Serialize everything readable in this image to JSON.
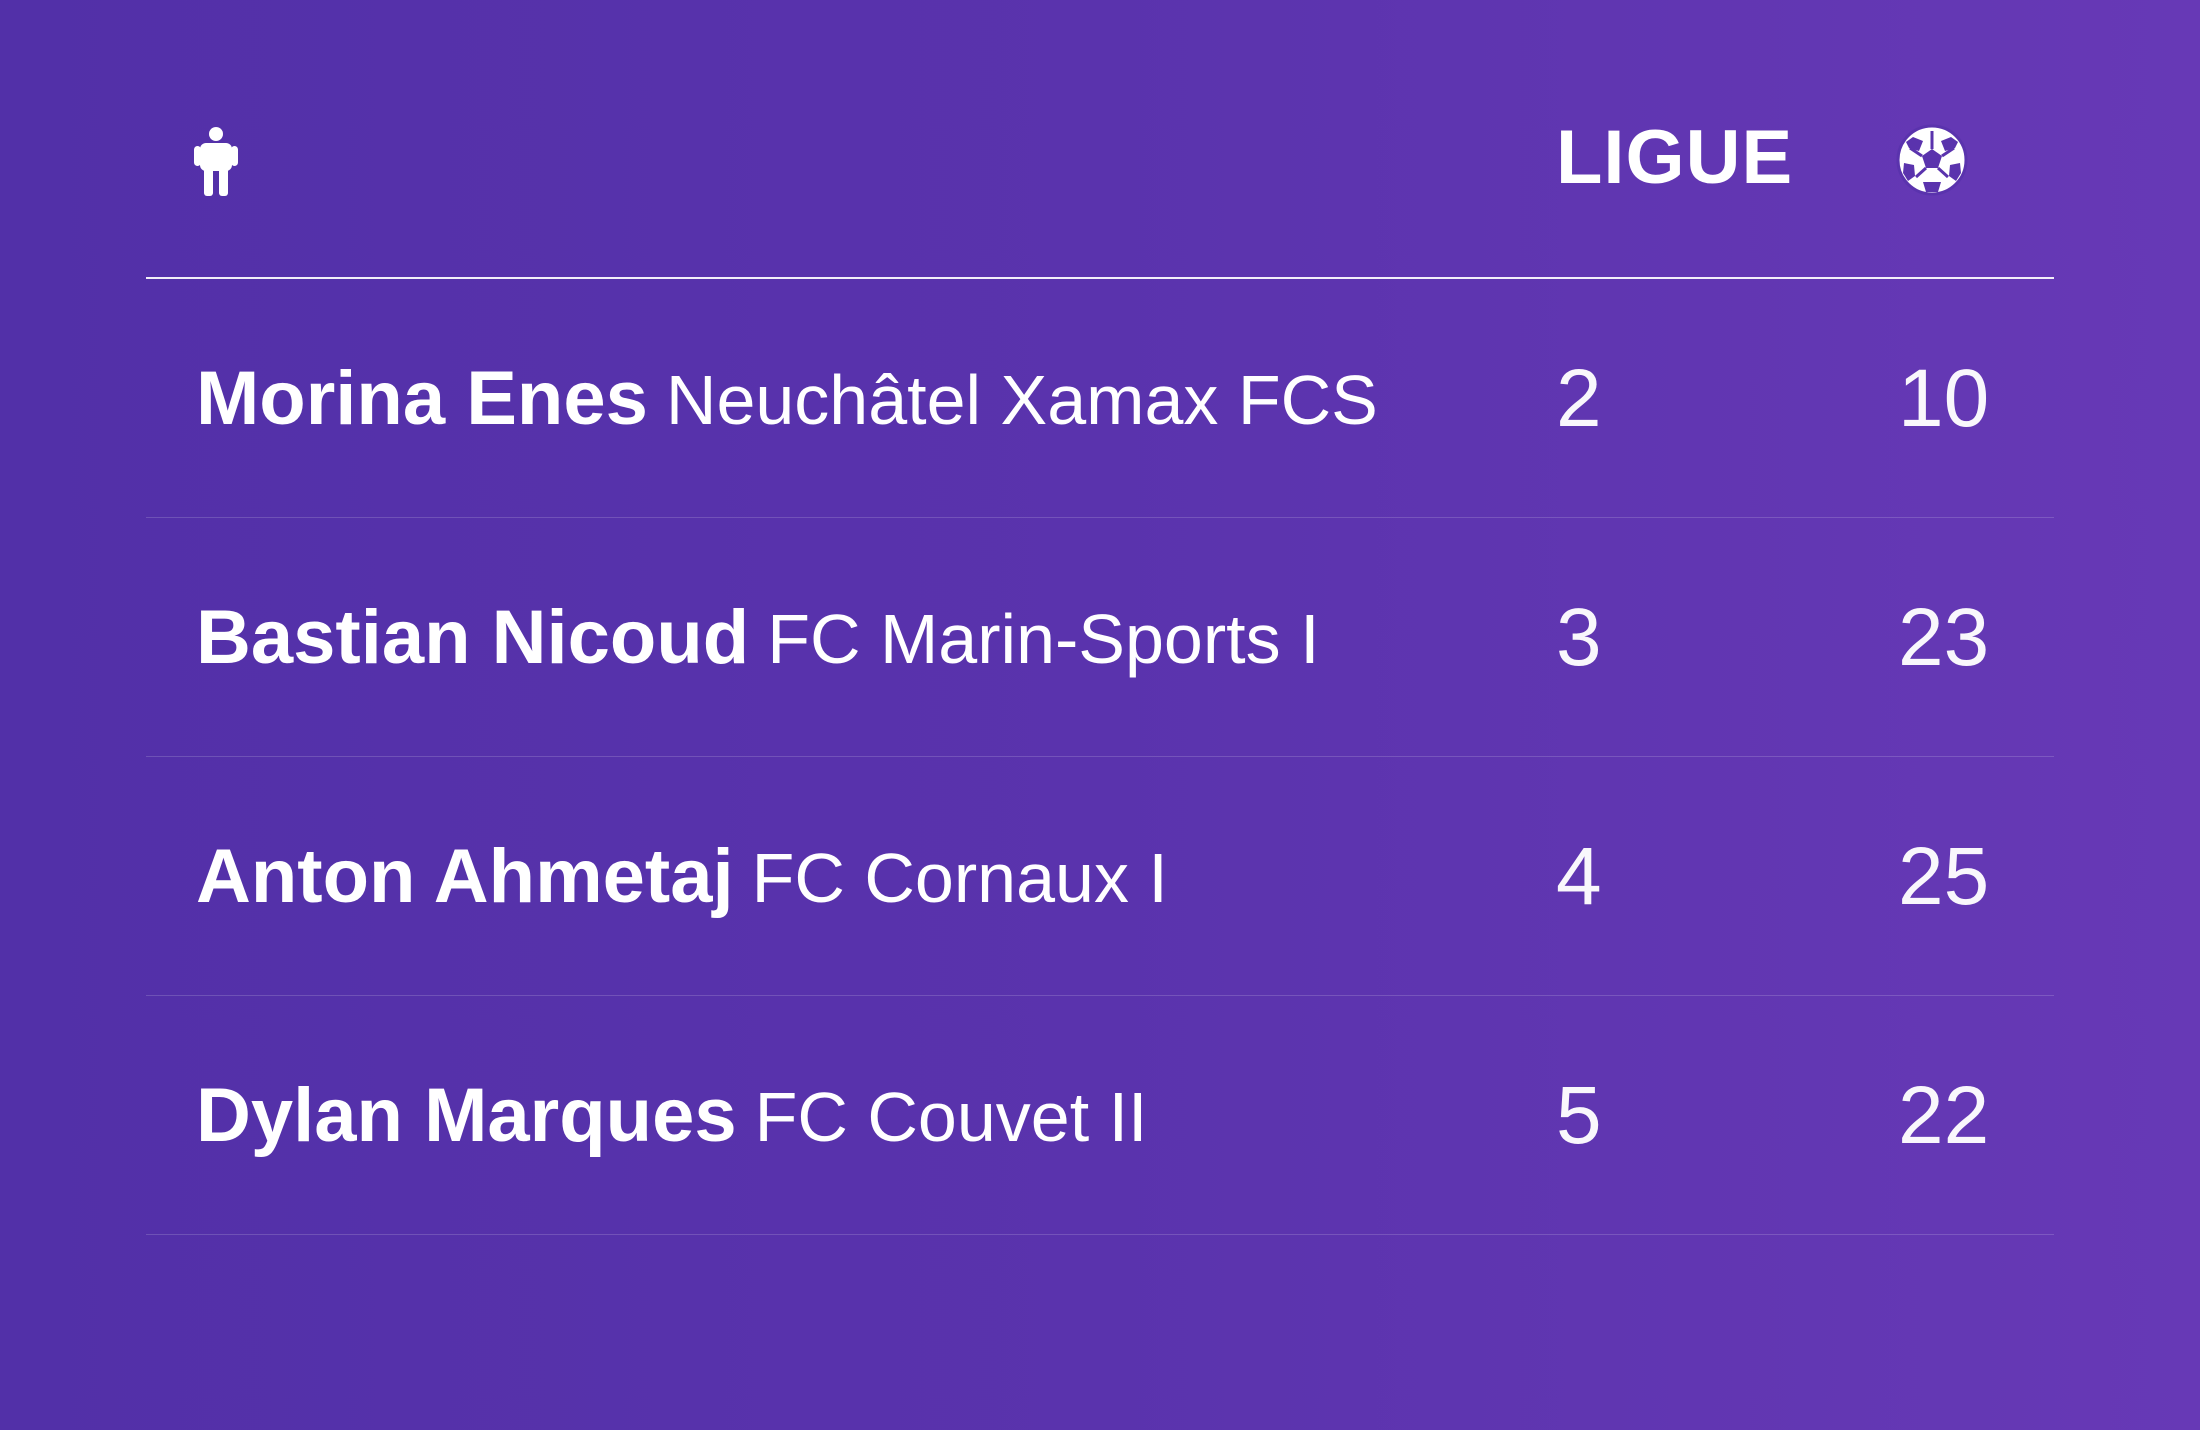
{
  "table": {
    "header": {
      "player_icon": "person-icon",
      "league_label": "LIGUE",
      "goals_icon": "soccer-ball-icon"
    },
    "rows": [
      {
        "name": "Morina Enes",
        "club": "Neuchâtel Xamax FCS",
        "league": "2",
        "goals": "10"
      },
      {
        "name": "Bastian Nicoud",
        "club": "FC Marin-Sports I",
        "league": "3",
        "goals": "23"
      },
      {
        "name": "Anton Ahmetaj",
        "club": "FC Cornaux I",
        "league": "4",
        "goals": "25"
      },
      {
        "name": "Dylan Marques",
        "club": "FC Couvet II",
        "league": "5",
        "goals": "22"
      }
    ]
  },
  "colors": {
    "background_start": "#5230a8",
    "background_end": "#6739b6",
    "text": "#ffffff"
  }
}
